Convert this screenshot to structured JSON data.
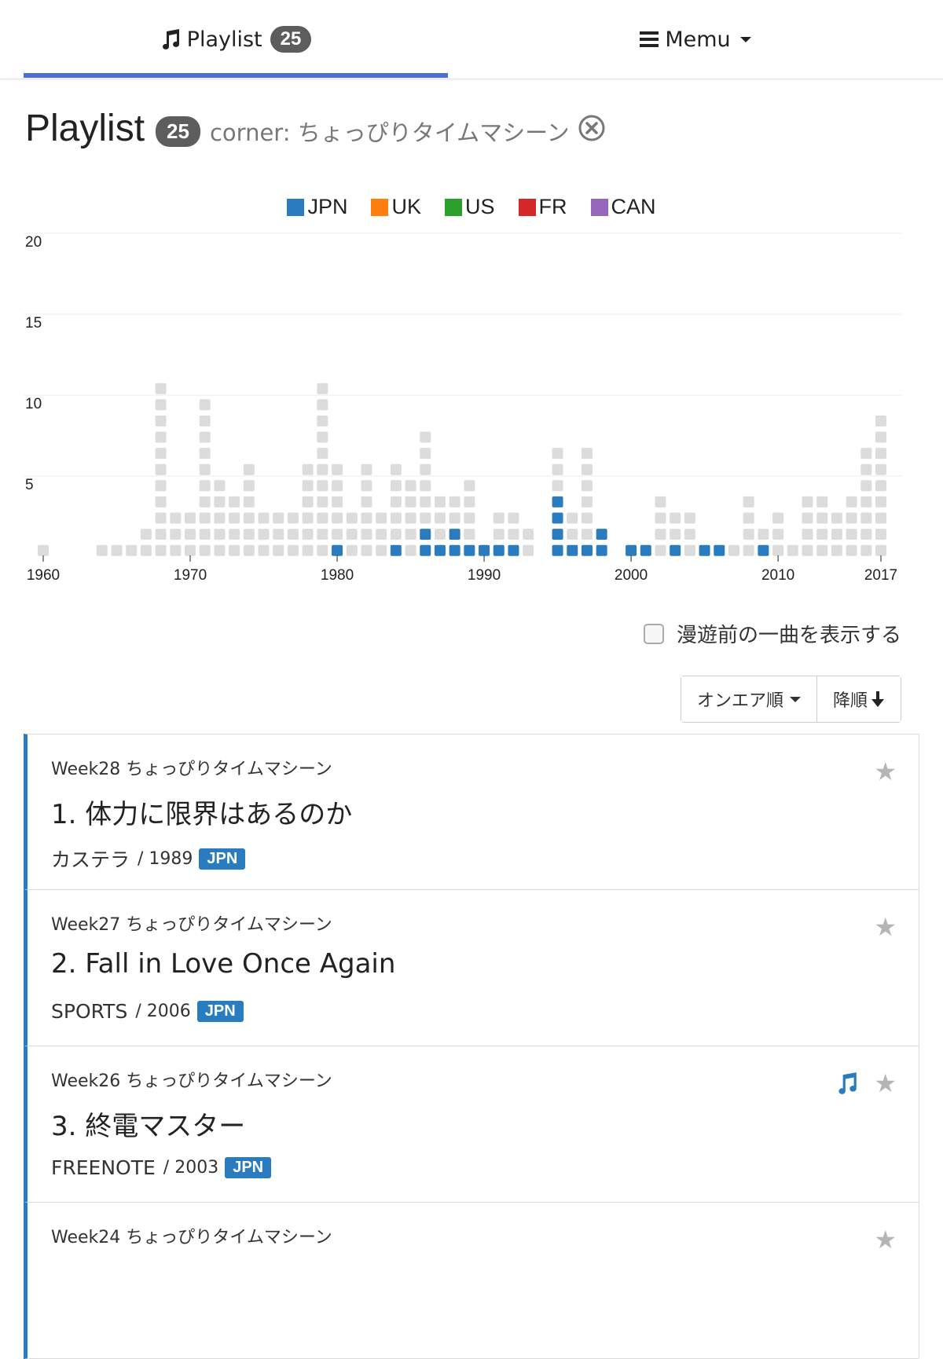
{
  "nav": {
    "playlist_label": "Playlist",
    "playlist_count": "25",
    "memu_label": "Memu"
  },
  "heading": {
    "title": "Playlist",
    "count": "25",
    "filter": "corner: ちょっぴりタイムマシーン"
  },
  "colors": {
    "accent": "#4a6fd9",
    "jpn": "#2a7cc0",
    "uk": "#ff7f0e",
    "us": "#2ca02c",
    "fr": "#d62728",
    "can": "#9467bd",
    "other": "#dcdcdc",
    "badge": "#5d5d5d"
  },
  "chart_data": {
    "type": "bar",
    "stacked_squares": true,
    "legend": [
      {
        "name": "JPN",
        "color": "#2a7cc0"
      },
      {
        "name": "UK",
        "color": "#ff7f0e"
      },
      {
        "name": "US",
        "color": "#2ca02c"
      },
      {
        "name": "FR",
        "color": "#d62728"
      },
      {
        "name": "CAN",
        "color": "#9467bd"
      }
    ],
    "legend_position": "top-center",
    "ylim": [
      0,
      20
    ],
    "yticks": [
      "5",
      "10",
      "15",
      "20"
    ],
    "xticks": [
      "1960",
      "1970",
      "1980",
      "1990",
      "2000",
      "2010",
      "2017"
    ],
    "x": [
      1960,
      1961,
      1962,
      1963,
      1964,
      1965,
      1966,
      1967,
      1968,
      1969,
      1970,
      1971,
      1972,
      1973,
      1974,
      1975,
      1976,
      1977,
      1978,
      1979,
      1980,
      1981,
      1982,
      1983,
      1984,
      1985,
      1986,
      1987,
      1988,
      1989,
      1990,
      1991,
      1992,
      1993,
      1994,
      1995,
      1996,
      1997,
      1998,
      1999,
      2000,
      2001,
      2002,
      2003,
      2004,
      2005,
      2006,
      2007,
      2008,
      2009,
      2010,
      2011,
      2012,
      2013,
      2014,
      2015,
      2016,
      2017
    ],
    "series": [
      {
        "name": "JPN",
        "values": [
          0,
          0,
          0,
          0,
          0,
          0,
          0,
          0,
          0,
          0,
          0,
          0,
          0,
          0,
          0,
          0,
          0,
          0,
          0,
          0,
          1,
          0,
          0,
          0,
          1,
          0,
          2,
          1,
          2,
          1,
          1,
          1,
          1,
          0,
          0,
          4,
          1,
          1,
          2,
          0,
          1,
          1,
          0,
          1,
          0,
          1,
          1,
          0,
          0,
          1,
          0,
          0,
          0,
          0,
          0,
          0,
          0,
          0
        ]
      },
      {
        "name": "other",
        "values": [
          1,
          0,
          0,
          0,
          1,
          1,
          1,
          2,
          11,
          3,
          3,
          10,
          5,
          4,
          6,
          3,
          3,
          3,
          6,
          11,
          5,
          3,
          6,
          3,
          5,
          5,
          6,
          3,
          2,
          4,
          0,
          2,
          2,
          2,
          0,
          3,
          2,
          6,
          0,
          0,
          0,
          0,
          4,
          2,
          3,
          0,
          0,
          1,
          4,
          1,
          3,
          1,
          4,
          4,
          3,
          4,
          7,
          9
        ]
      }
    ]
  },
  "options": {
    "show_prev_song": "漫遊前の一曲を表示する",
    "sort_label": "オンエア順",
    "order_label": "降順"
  },
  "playlist": [
    {
      "week": "Week28 ちょっぴりタイムマシーン",
      "title": "1. 体力に限界はあるのか",
      "artist": "カステラ",
      "year": "/ 1989",
      "country": "JPN",
      "has_audio": false
    },
    {
      "week": "Week27 ちょっぴりタイムマシーン",
      "title": "2. Fall in Love Once Again",
      "artist": "SPORTS",
      "year": "/ 2006",
      "country": "JPN",
      "has_audio": false
    },
    {
      "week": "Week26 ちょっぴりタイムマシーン",
      "title": "3. 終電マスター",
      "artist": "FREENOTE",
      "year": "/ 2003",
      "country": "JPN",
      "has_audio": true
    },
    {
      "week": "Week24 ちょっぴりタイムマシーン",
      "title": "",
      "artist": "",
      "year": "",
      "country": "",
      "has_audio": false
    }
  ]
}
